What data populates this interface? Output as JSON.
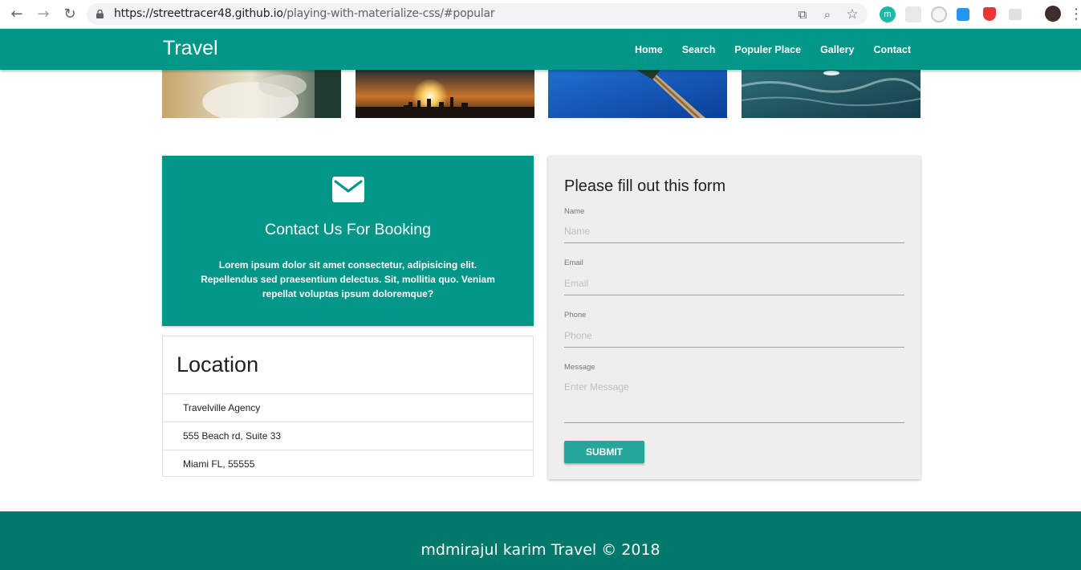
{
  "browser": {
    "url_host": "https://streettracer48.github.io",
    "url_path": "/playing-with-materialize-css/#popular",
    "back_glyph": "←",
    "forward_glyph": "→",
    "reload_glyph": "↻",
    "translate_glyph": "⧉",
    "zoom_glyph": "⌕",
    "star_glyph": "☆",
    "menu_glyph": "⋮",
    "extension_label": "m",
    "extensions": [
      "m-icon",
      "grid-icon",
      "clock-icon",
      "cast-icon",
      "shield-icon",
      "chat-icon"
    ]
  },
  "navbar": {
    "brand": "Travel",
    "links": [
      "Home",
      "Search",
      "Populer Place",
      "Gallery",
      "Contact"
    ],
    "color": "#009688"
  },
  "images": [
    {
      "name": "waves-image"
    },
    {
      "name": "sunset-city-image"
    },
    {
      "name": "palm-sky-image"
    },
    {
      "name": "ocean-boat-image"
    }
  ],
  "contact": {
    "title": "Contact Us For Booking",
    "text": "Lorem ipsum dolor sit amet consectetur, adipisicing elit. Repellendus sed praesentium delectus. Sit, mollitia quo. Veniam repellat voluptas ipsum doloremque?",
    "icon": "mail-icon"
  },
  "location": {
    "title": "Location",
    "items": [
      "Travelville Agency",
      "555 Beach rd, Suite 33",
      "Miami FL, 55555"
    ]
  },
  "form": {
    "title": "Please fill out this form",
    "name_label": "Name",
    "name_placeholder": "Name",
    "email_label": "Email",
    "email_placeholder": "Email",
    "phone_label": "Phone",
    "phone_placeholder": "Phone",
    "message_label": "Message",
    "message_placeholder": "Enter Message",
    "submit": "SUBMIT"
  },
  "footer": {
    "text": "mdmirajul karim Travel © 2018",
    "color": "#00796b"
  }
}
